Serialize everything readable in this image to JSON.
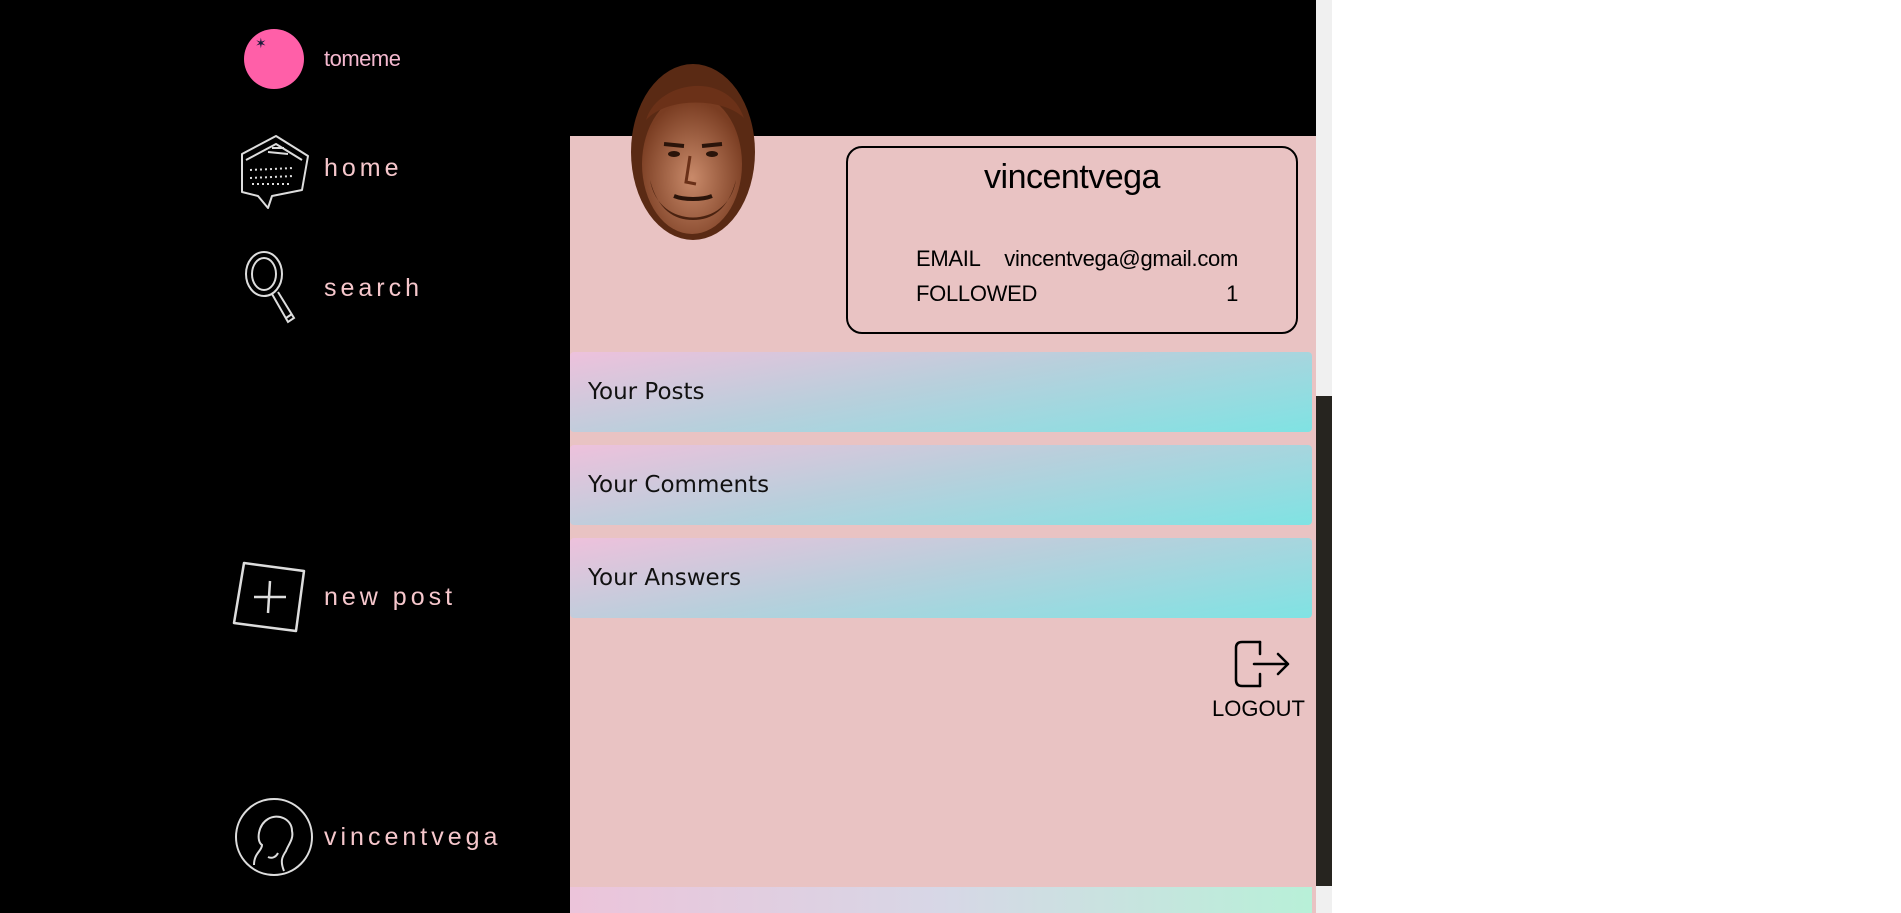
{
  "brand": {
    "name": "tomeme",
    "logo_color": "#ff5fa8"
  },
  "sidebar": {
    "items": [
      {
        "label": "home",
        "icon": "home-tag-icon"
      },
      {
        "label": "search",
        "icon": "magnifier-icon"
      },
      {
        "label": "new post",
        "icon": "plus-square-icon"
      },
      {
        "label": "vincentvega",
        "icon": "profile-silhouette-icon"
      }
    ]
  },
  "profile": {
    "username": "vincentvega",
    "email_label": "EMAIL",
    "email": "vincentvega@gmail.com",
    "followed_label": "FOLLOWED",
    "followed": "1"
  },
  "sections": [
    {
      "label": "Your Posts"
    },
    {
      "label": "Your Comments"
    },
    {
      "label": "Your Answers"
    }
  ],
  "logout": {
    "label": "LOGOUT",
    "icon": "logout-icon"
  },
  "colors": {
    "background": "#000000",
    "panel": "#e9c3c3",
    "accent_pink": "#f4b8cf",
    "tab_gradient_start": "#eec1dc",
    "tab_gradient_end": "#7fe3e3"
  }
}
